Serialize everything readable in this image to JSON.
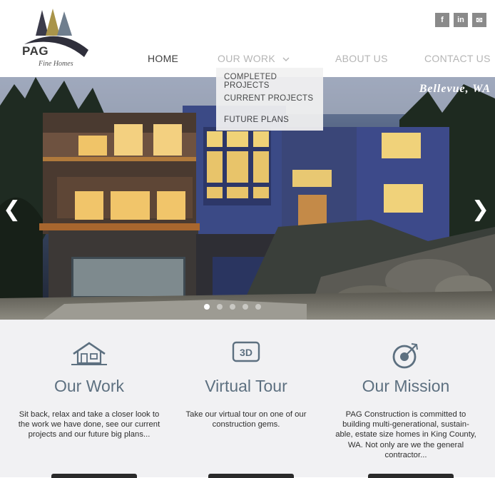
{
  "logo": {
    "name": "PAG",
    "tagline": "Fine Homes"
  },
  "social": [
    {
      "icon": "facebook-icon",
      "glyph": "f"
    },
    {
      "icon": "linkedin-icon",
      "glyph": "in"
    },
    {
      "icon": "email-icon",
      "glyph": "✉"
    }
  ],
  "nav": {
    "home": "HOME",
    "our_work": "OUR WORK",
    "about": "ABOUT US",
    "contact": "CONTACT US"
  },
  "dropdown": {
    "items": [
      "COMPLETED PROJECTS",
      "CURRENT PROJECTS",
      "FUTURE PLANS"
    ]
  },
  "hero": {
    "location": "Bellevue, WA",
    "slide_count": 5,
    "active_slide": 1
  },
  "features": [
    {
      "title": "Our Work",
      "icon": "house-icon",
      "text": "Sit back, relax and take a closer look to the work we have done, see our current projects and our future big plans..."
    },
    {
      "title": "Virtual Tour",
      "icon": "3d-icon",
      "icon_text": "3D",
      "text": "Take our virtual tour on one of our construction gems."
    },
    {
      "title": "Our Mission",
      "icon": "target-icon",
      "text": "PAG Construction is committed to building multi-generational, sustain-able, estate size homes in King County, WA.  Not only are we the general contractor..."
    }
  ],
  "colors": {
    "accent": "#5d7080",
    "logo_gold": "#a9944a",
    "logo_dark": "#3b3b4a",
    "nav_dim": "#b5b5b5"
  }
}
